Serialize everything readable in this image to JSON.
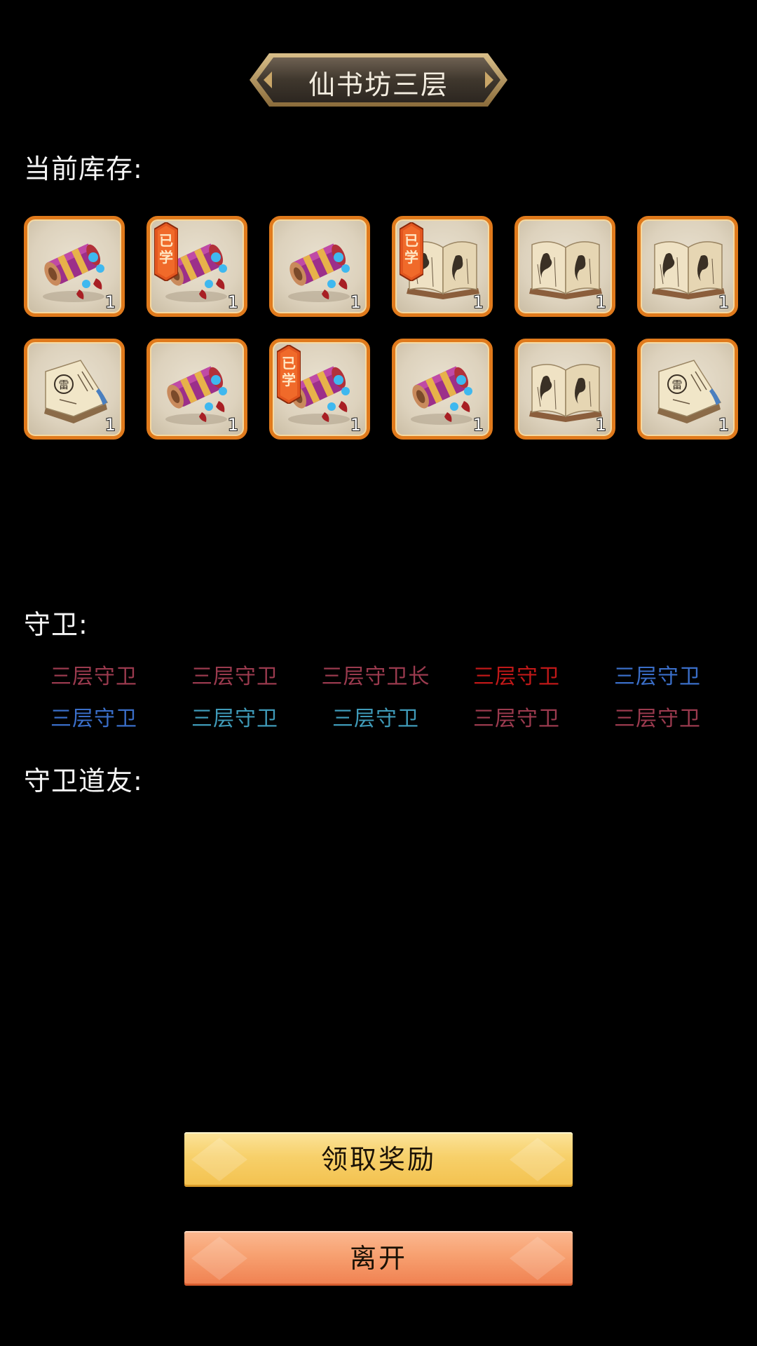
{
  "title": "仙书坊三层",
  "labels": {
    "stock": "当前库存:",
    "guards": "守卫:",
    "friends": "守卫道友:"
  },
  "inventory": [
    {
      "item": "scroll-icon",
      "count": "1",
      "learned": false
    },
    {
      "item": "scroll-icon",
      "count": "1",
      "learned": true
    },
    {
      "item": "scroll-icon",
      "count": "1",
      "learned": false
    },
    {
      "item": "open-book-icon",
      "count": "1",
      "learned": true
    },
    {
      "item": "open-book-icon",
      "count": "1",
      "learned": false
    },
    {
      "item": "open-book-icon",
      "count": "1",
      "learned": false
    },
    {
      "item": "thunder-manual-icon",
      "count": "1",
      "learned": false
    },
    {
      "item": "scroll-icon",
      "count": "1",
      "learned": false
    },
    {
      "item": "scroll-icon",
      "count": "1",
      "learned": true
    },
    {
      "item": "scroll-icon",
      "count": "1",
      "learned": false
    },
    {
      "item": "open-book-icon",
      "count": "1",
      "learned": false
    },
    {
      "item": "thunder-manual-icon",
      "count": "1",
      "learned": false
    }
  ],
  "learned_tag": "已学",
  "manual_glyph": "雷",
  "guards": [
    {
      "name": "三层守卫",
      "color": "#9a3a4e"
    },
    {
      "name": "三层守卫",
      "color": "#9a3a4e"
    },
    {
      "name": "三层守卫长",
      "color": "#9a3a4e"
    },
    {
      "name": "三层守卫",
      "color": "#c01818"
    },
    {
      "name": "三层守卫",
      "color": "#3a6ec8"
    },
    {
      "name": "三层守卫",
      "color": "#3a6ec8"
    },
    {
      "name": "三层守卫",
      "color": "#3f9ab8"
    },
    {
      "name": "三层守卫",
      "color": "#3f9ab8"
    },
    {
      "name": "三层守卫",
      "color": "#9a3a4e"
    },
    {
      "name": "三层守卫",
      "color": "#9a3a4e"
    }
  ],
  "buttons": {
    "claim": "领取奖励",
    "leave": "离开"
  }
}
